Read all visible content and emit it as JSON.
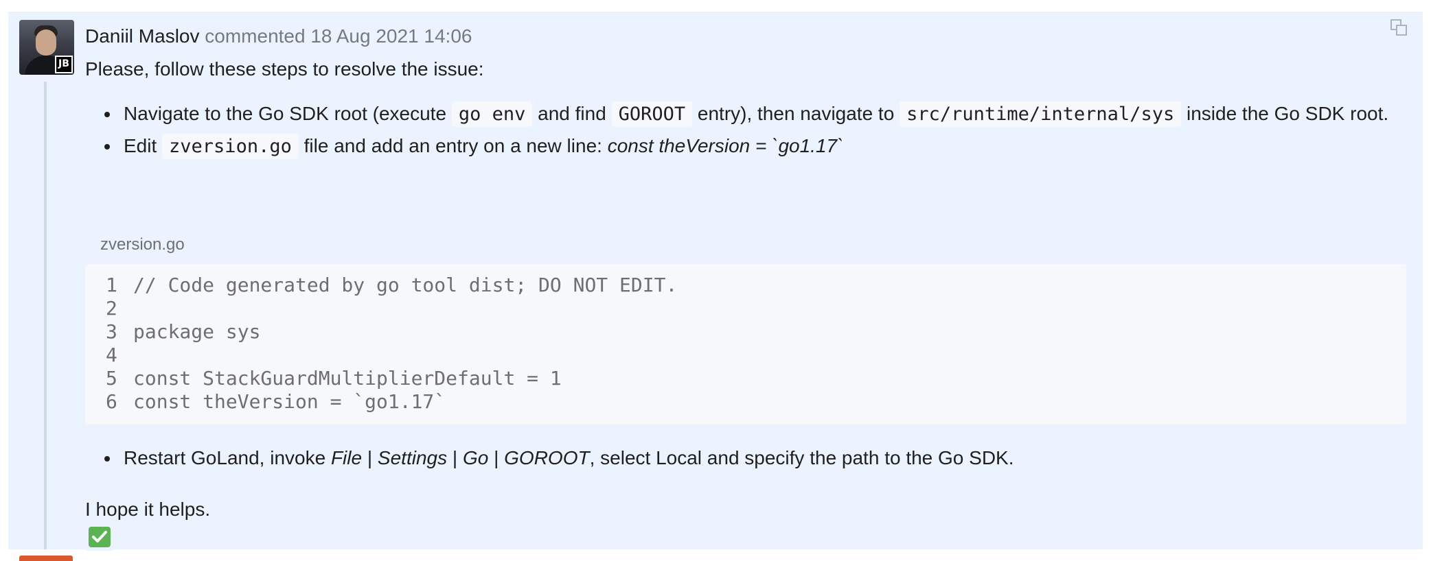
{
  "comment": {
    "author": "Daniil Maslov",
    "action": "commented",
    "timestamp": "18 Aug 2021 14:06",
    "avatar_badge": "JB",
    "intro": "Please, follow these steps to resolve the issue:",
    "step1": {
      "t1": "Navigate to the Go SDK root (execute ",
      "code1": "go env",
      "t2": " and find ",
      "code2": "GOROOT",
      "t3": " entry), then navigate to ",
      "code3": "src/runtime/internal/sys",
      "t4": " inside the Go SDK root."
    },
    "step2": {
      "t1": "Edit ",
      "code1": "zversion.go",
      "t2": " file and add an entry on a new line: ",
      "em1": "const theVersion = `go1.17`"
    },
    "file_label": "zversion.go",
    "code_lines": [
      {
        "num": "1",
        "text": "// Code generated by go tool dist; DO NOT EDIT."
      },
      {
        "num": "2",
        "text": ""
      },
      {
        "num": "3",
        "text": "package sys"
      },
      {
        "num": "4",
        "text": ""
      },
      {
        "num": "5",
        "text": "const StackGuardMultiplierDefault = 1"
      },
      {
        "num": "6",
        "text": "const theVersion = `go1.17`"
      }
    ],
    "step3": {
      "t1": "Restart GoLand, invoke ",
      "em1": "File",
      "sep1": " | ",
      "em2": "Settings",
      "sep2": " | ",
      "em3": "Go",
      "sep3": " | ",
      "em4": "GOROOT",
      "t2": ", select Local and specify the path to the Go SDK."
    },
    "closing": "I hope it helps.",
    "reaction_icon": "check-mark-icon",
    "copy_icon": "copy-link-icon"
  },
  "colors": {
    "comment_bg": "#eaf3fe",
    "code_bg": "#f6f8fb",
    "meta_text": "#737a82",
    "reaction_green": "#5bb353",
    "accent_tag": "#d9582e"
  }
}
